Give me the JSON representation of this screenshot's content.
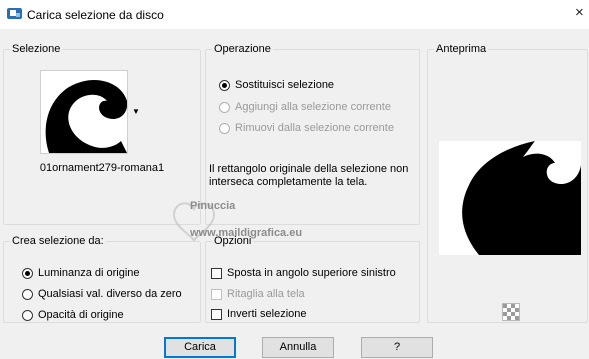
{
  "window": {
    "title": "Carica selezione da disco",
    "close_icon": "×"
  },
  "selezione": {
    "legend": "Selezione",
    "file_name": "01ornament279-romana1",
    "dropdown_icon": "▼"
  },
  "operazione": {
    "legend": "Operazione",
    "options": [
      "Sostituisci selezione",
      "Aggiungi alla selezione corrente",
      "Rimuovi dalla selezione corrente"
    ],
    "selected": 0,
    "disabled": [
      1,
      2
    ],
    "info": "Il rettangolo originale della selezione non interseca completamente la tela."
  },
  "anteprima": {
    "legend": "Anteprima"
  },
  "crea": {
    "legend": "Crea selezione da:",
    "options": [
      "Luminanza di origine",
      "Qualsiasi val. diverso da zero",
      "Opacità di origine"
    ],
    "selected": 0
  },
  "opzioni": {
    "legend": "Opzioni",
    "items": [
      {
        "label": "Sposta in angolo superiore sinistro",
        "checked": false,
        "enabled": true
      },
      {
        "label": "Ritaglia alla tela",
        "checked": false,
        "enabled": false
      },
      {
        "label": "Inverti selezione",
        "checked": false,
        "enabled": true
      }
    ]
  },
  "watermark": {
    "line1": "Pinuccia",
    "line2": "www.maildigrafica.eu"
  },
  "buttons": {
    "carica": "Carica",
    "annulla": "Annulla",
    "help": "?"
  }
}
